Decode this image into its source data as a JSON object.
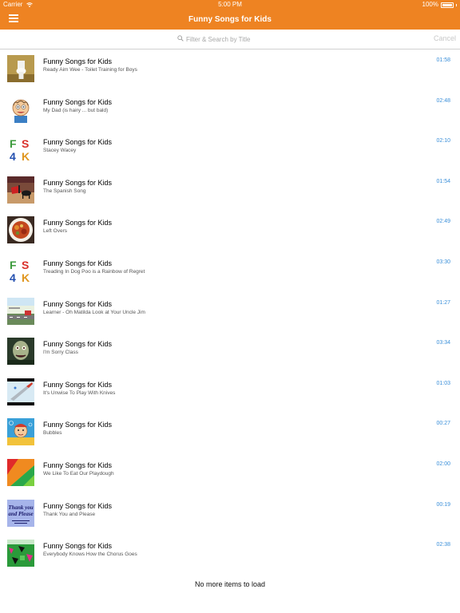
{
  "status": {
    "carrier": "Carrier",
    "time": "5:00 PM",
    "battery": "100%"
  },
  "header": {
    "title": "Funny Songs for Kids"
  },
  "search": {
    "placeholder": "Filter & Search by Title",
    "cancel_label": "Cancel"
  },
  "items": [
    {
      "title": "Funny Songs for Kids",
      "subtitle": "Ready Aim Wee - Toilet Training for Boys",
      "duration": "01:58",
      "thumb": "toilet-image"
    },
    {
      "title": "Funny Songs for Kids",
      "subtitle": "My Dad (is hairy ... but bald)",
      "duration": "02:48",
      "thumb": "cartoon-dad-image"
    },
    {
      "title": "Funny Songs for Kids",
      "subtitle": "Stacey Wacey",
      "duration": "02:10",
      "thumb": "fs4k-logo"
    },
    {
      "title": "Funny Songs for Kids",
      "subtitle": "The Spanish Song",
      "duration": "01:54",
      "thumb": "bullfight-image"
    },
    {
      "title": "Funny Songs for Kids",
      "subtitle": "Left Overs",
      "duration": "02:49",
      "thumb": "food-plate-image"
    },
    {
      "title": "Funny Songs for Kids",
      "subtitle": "Treading In Dog Poo is a Rainbow of Regret",
      "duration": "03:30",
      "thumb": "fs4k-logo"
    },
    {
      "title": "Funny Songs for Kids",
      "subtitle": "Learner - Oh Matilda Look at Your Uncle Jim",
      "duration": "01:27",
      "thumb": "road-image"
    },
    {
      "title": "Funny Songs for Kids",
      "subtitle": "I'm Sorry Class",
      "duration": "03:34",
      "thumb": "zombie-image"
    },
    {
      "title": "Funny Songs for Kids",
      "subtitle": "It's Unwise To Play With Knives",
      "duration": "01:03",
      "thumb": "knife-image"
    },
    {
      "title": "Funny Songs for Kids",
      "subtitle": "Bubbles",
      "duration": "00:27",
      "thumb": "cartoon-bubbles-image"
    },
    {
      "title": "Funny Songs for Kids",
      "subtitle": "We Like To Eat Our Playdough",
      "duration": "02:00",
      "thumb": "playdough-image"
    },
    {
      "title": "Funny Songs for Kids",
      "subtitle": "Thank You and Please",
      "duration": "00:19",
      "thumb": "thank-you-card-image",
      "thumb_text": [
        "Thank you",
        "and Please"
      ]
    },
    {
      "title": "Funny Songs for Kids",
      "subtitle": "Everybody Knows How the Chorus Goes",
      "duration": "02:38",
      "thumb": "green-chorus-image"
    }
  ],
  "footer": {
    "text": "No more items to load"
  },
  "colors": {
    "header": "#ee8322",
    "duration": "#3a8fd9",
    "placeholder": "#a8a8a8",
    "cancel": "#c8c8c8"
  }
}
